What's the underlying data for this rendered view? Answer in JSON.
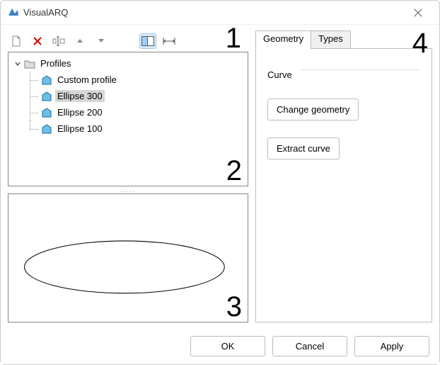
{
  "window": {
    "title": "VisualARQ"
  },
  "overlays": {
    "n1": "1",
    "n2": "2",
    "n3": "3",
    "n4": "4"
  },
  "tree": {
    "root": "Profiles",
    "items": [
      {
        "label": "Custom profile",
        "selected": false
      },
      {
        "label": "Ellipse 300",
        "selected": true
      },
      {
        "label": "Ellipse 200",
        "selected": false
      },
      {
        "label": "Ellipse 100",
        "selected": false
      }
    ]
  },
  "tabs": {
    "geometry": "Geometry",
    "types": "Types",
    "group_curve": "Curve",
    "change_geom": "Change geometry",
    "extract_curve": "Extract curve"
  },
  "footer": {
    "ok": "OK",
    "cancel": "Cancel",
    "apply": "Apply"
  },
  "splitter": "....."
}
